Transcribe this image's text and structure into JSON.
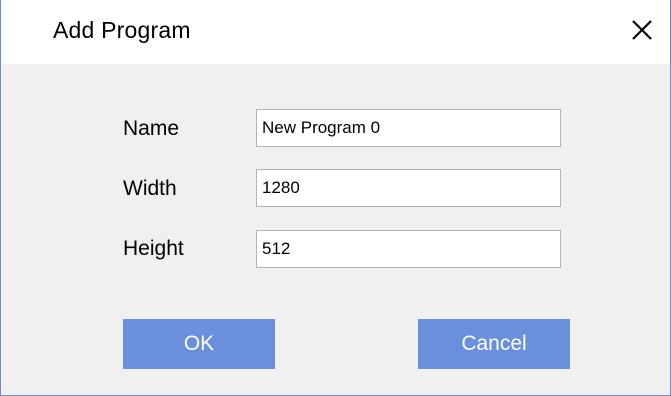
{
  "dialog": {
    "title": "Add Program",
    "close_icon": "close-icon"
  },
  "form": {
    "name_label": "Name",
    "name_value": "New Program 0",
    "width_label": "Width",
    "width_value": "1280",
    "height_label": "Height",
    "height_value": "512"
  },
  "buttons": {
    "ok_label": "OK",
    "cancel_label": "Cancel"
  },
  "colors": {
    "button_bg": "#6a8fdd",
    "dialog_bg": "#f0f0f0",
    "border": "#6e8fc9"
  }
}
